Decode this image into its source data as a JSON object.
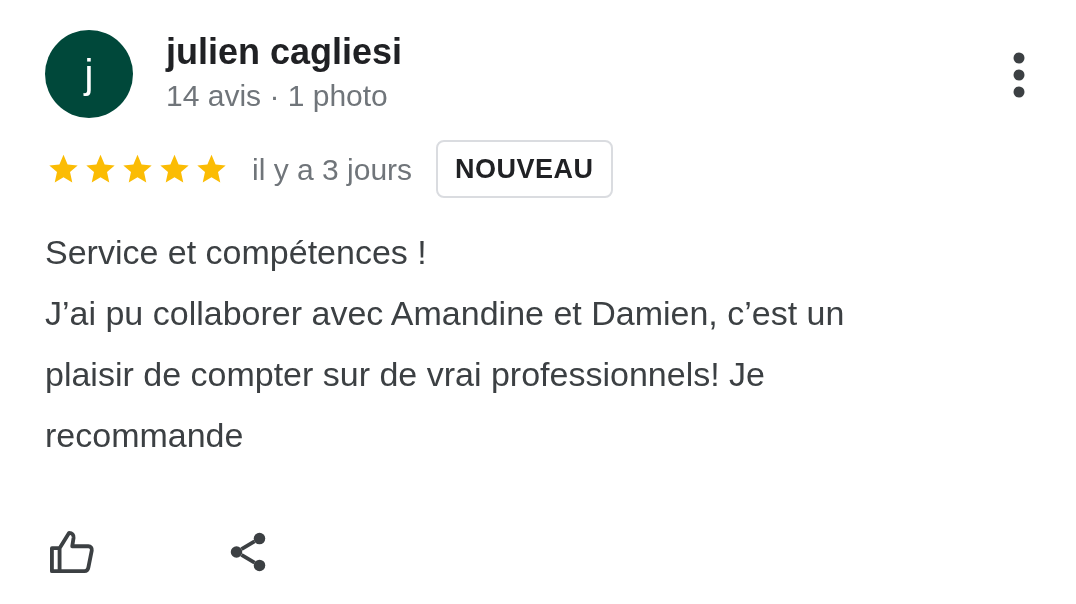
{
  "reviewer": {
    "initial": "j",
    "name": "julien cagliesi",
    "meta": "14 avis · 1 photo"
  },
  "rating": {
    "stars": 5,
    "date": "il y a 3 jours",
    "badge": "NOUVEAU"
  },
  "review": {
    "lines": [
      "Service et compétences !",
      "J’ai pu collaborer avec Amandine et Damien, c’est un",
      "plaisir de compter sur de vrai professionnels! Je",
      "recommande"
    ]
  }
}
